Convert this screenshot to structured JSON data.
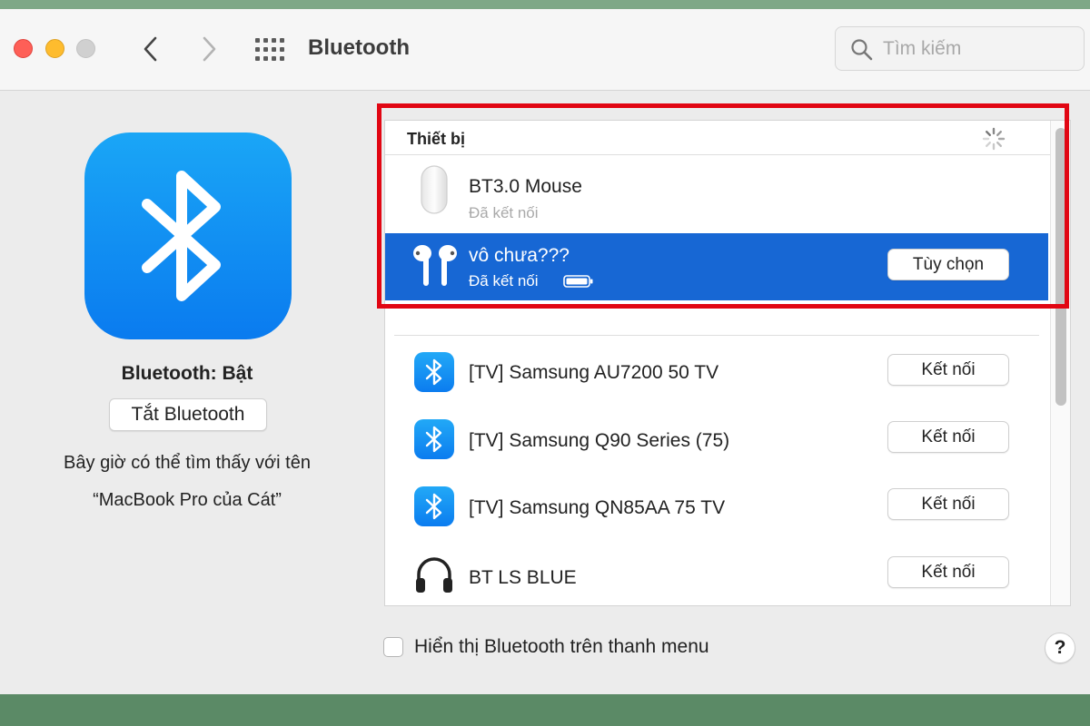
{
  "window": {
    "title": "Bluetooth",
    "search_placeholder": "Tìm kiếm"
  },
  "left_pane": {
    "status": "Bluetooth: Bật",
    "toggle_button": "Tắt Bluetooth",
    "discover_line1": "Bây giờ có thể tìm thấy với tên",
    "discover_line2": "“MacBook Pro của Cát”"
  },
  "devices": {
    "header": "Thiết bị",
    "connected": [
      {
        "name": "BT3.0 Mouse",
        "status": "Đã kết nối",
        "icon": "mouse-icon"
      },
      {
        "name": "vô chưa???",
        "status": "Đã kết nối",
        "icon": "airpods-icon",
        "button": "Tùy chọn",
        "selected": true
      }
    ],
    "nearby": [
      {
        "name": "[TV] Samsung AU7200 50 TV",
        "icon": "bluetooth-icon",
        "button": "Kết nối"
      },
      {
        "name": "[TV] Samsung Q90 Series (75)",
        "icon": "bluetooth-icon",
        "button": "Kết nối"
      },
      {
        "name": "[TV] Samsung QN85AA 75 TV",
        "icon": "bluetooth-icon",
        "button": "Kết nối"
      },
      {
        "name": "BT LS BLUE",
        "icon": "headphones-icon",
        "button": "Kết nối"
      }
    ]
  },
  "footer": {
    "menu_checkbox_label": "Hiển thị Bluetooth trên thanh menu",
    "menu_checkbox_checked": false,
    "help_label": "?"
  },
  "colors": {
    "selection": "#1767d4",
    "highlight_box": "#e10613",
    "bluetooth_blue": "#0a7bef"
  }
}
